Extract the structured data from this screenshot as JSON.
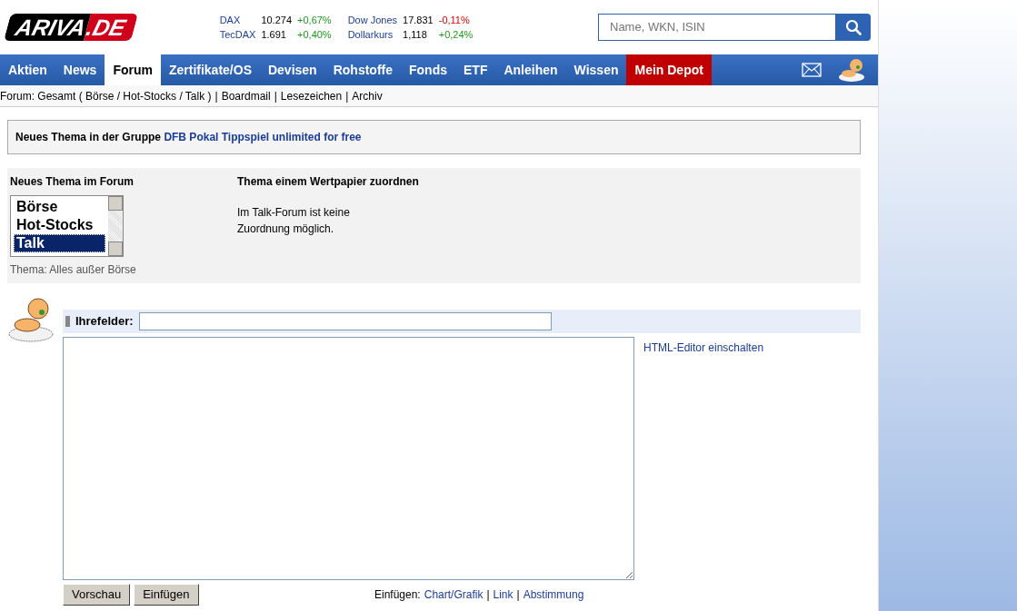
{
  "logo": {
    "text": "ARIVA",
    "suffix": ".DE"
  },
  "quotes": [
    {
      "name": "DAX",
      "value": "10.274",
      "change": "+0,67%",
      "kind": "gain"
    },
    {
      "name": "TecDAX",
      "value": "1.691",
      "change": "+0,40%",
      "kind": "gain"
    },
    {
      "name": "Dow Jones",
      "value": "17.831",
      "change": "-0,11%",
      "kind": "loss"
    },
    {
      "name": "Dollarkurs",
      "value": "1,118",
      "change": "+0,24%",
      "kind": "gain"
    }
  ],
  "search": {
    "placeholder": "Name, WKN, ISIN"
  },
  "nav": [
    {
      "label": "Aktien",
      "selected": false,
      "kind": "normal"
    },
    {
      "label": "News",
      "selected": false,
      "kind": "normal"
    },
    {
      "label": "Forum",
      "selected": true,
      "kind": "normal"
    },
    {
      "label": "Zertifikate/OS",
      "selected": false,
      "kind": "normal"
    },
    {
      "label": "Devisen",
      "selected": false,
      "kind": "normal"
    },
    {
      "label": "Rohstoffe",
      "selected": false,
      "kind": "normal"
    },
    {
      "label": "Fonds",
      "selected": false,
      "kind": "normal"
    },
    {
      "label": "ETF",
      "selected": false,
      "kind": "normal"
    },
    {
      "label": "Anleihen",
      "selected": false,
      "kind": "normal"
    },
    {
      "label": "Wissen",
      "selected": false,
      "kind": "normal"
    },
    {
      "label": "Mein Depot",
      "selected": false,
      "kind": "depot"
    }
  ],
  "subnav": {
    "separator": "|",
    "items": [
      "Forum: Gesamt ( Börse / Hot-Stocks / Talk )",
      "Boardmail",
      "Lesezeichen",
      "Archiv"
    ]
  },
  "group_notice": {
    "text": "Neues Thema in der Gruppe",
    "link": "DFB Pokal Tippspiel unlimited for free"
  },
  "forum_select": {
    "title": "Neues Thema im Forum",
    "options": [
      {
        "label": "Börse",
        "selected": false
      },
      {
        "label": "Hot-Stocks",
        "selected": false
      },
      {
        "label": "Talk",
        "selected": true
      }
    ],
    "hint": "Thema: Alles außer Börse"
  },
  "security_assign": {
    "title": "Thema einem Wertpapier zuordnen",
    "text": "Im Talk-Forum ist keine Zuordnung möglich."
  },
  "subject": {
    "label": "Ihrefelder:"
  },
  "editor_toggle": "HTML-Editor einschalten",
  "buttons": [
    "Vorschau",
    "Einfügen"
  ],
  "insert": {
    "label": "Einfügen:",
    "separator": "|",
    "links": [
      "Chart/Grafik",
      "Link",
      "Abstimmung"
    ]
  }
}
